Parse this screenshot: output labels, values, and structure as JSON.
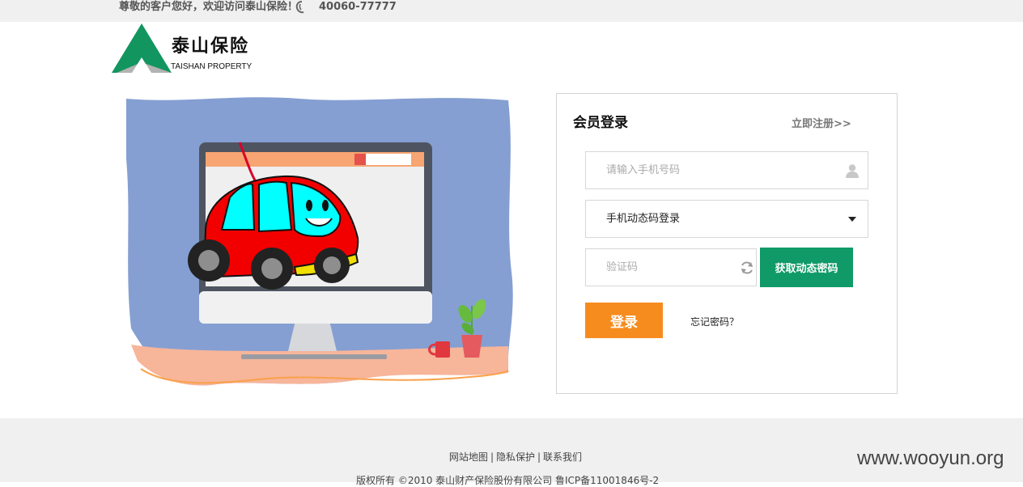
{
  "topbar": {
    "greeting": "尊敬的客户您好，欢迎访问泰山保险！",
    "phone_icon": "phone-handset-icon",
    "phone": "40060-77777"
  },
  "logo": {
    "brand_cn": "泰山保险",
    "brand_en": "TAISHAN PROPERTY",
    "colors": {
      "green": "#13955f",
      "gray": "#9e9e9e"
    }
  },
  "illustration": {
    "icon": "computer-with-cartoon-car-illustration"
  },
  "login": {
    "title": "会员登录",
    "register_link": "立即注册>>",
    "phone_placeholder": "请输入手机号码",
    "login_method": "手机动态码登录",
    "code_placeholder": "验证码",
    "get_code_button": "获取动态密码",
    "submit_button": "登录",
    "forgot_link": "忘记密码？",
    "colors": {
      "green_button": "#0f9a68",
      "orange_button": "#f78c1e"
    }
  },
  "footer": {
    "links": [
      "网站地图",
      "隐私保护",
      "联系我们"
    ],
    "separator": "|",
    "copyright": "版权所有 ©2010 泰山财产保险股份有限公司 鲁ICP备11001846号-2"
  },
  "watermark": "www.wooyun.org"
}
